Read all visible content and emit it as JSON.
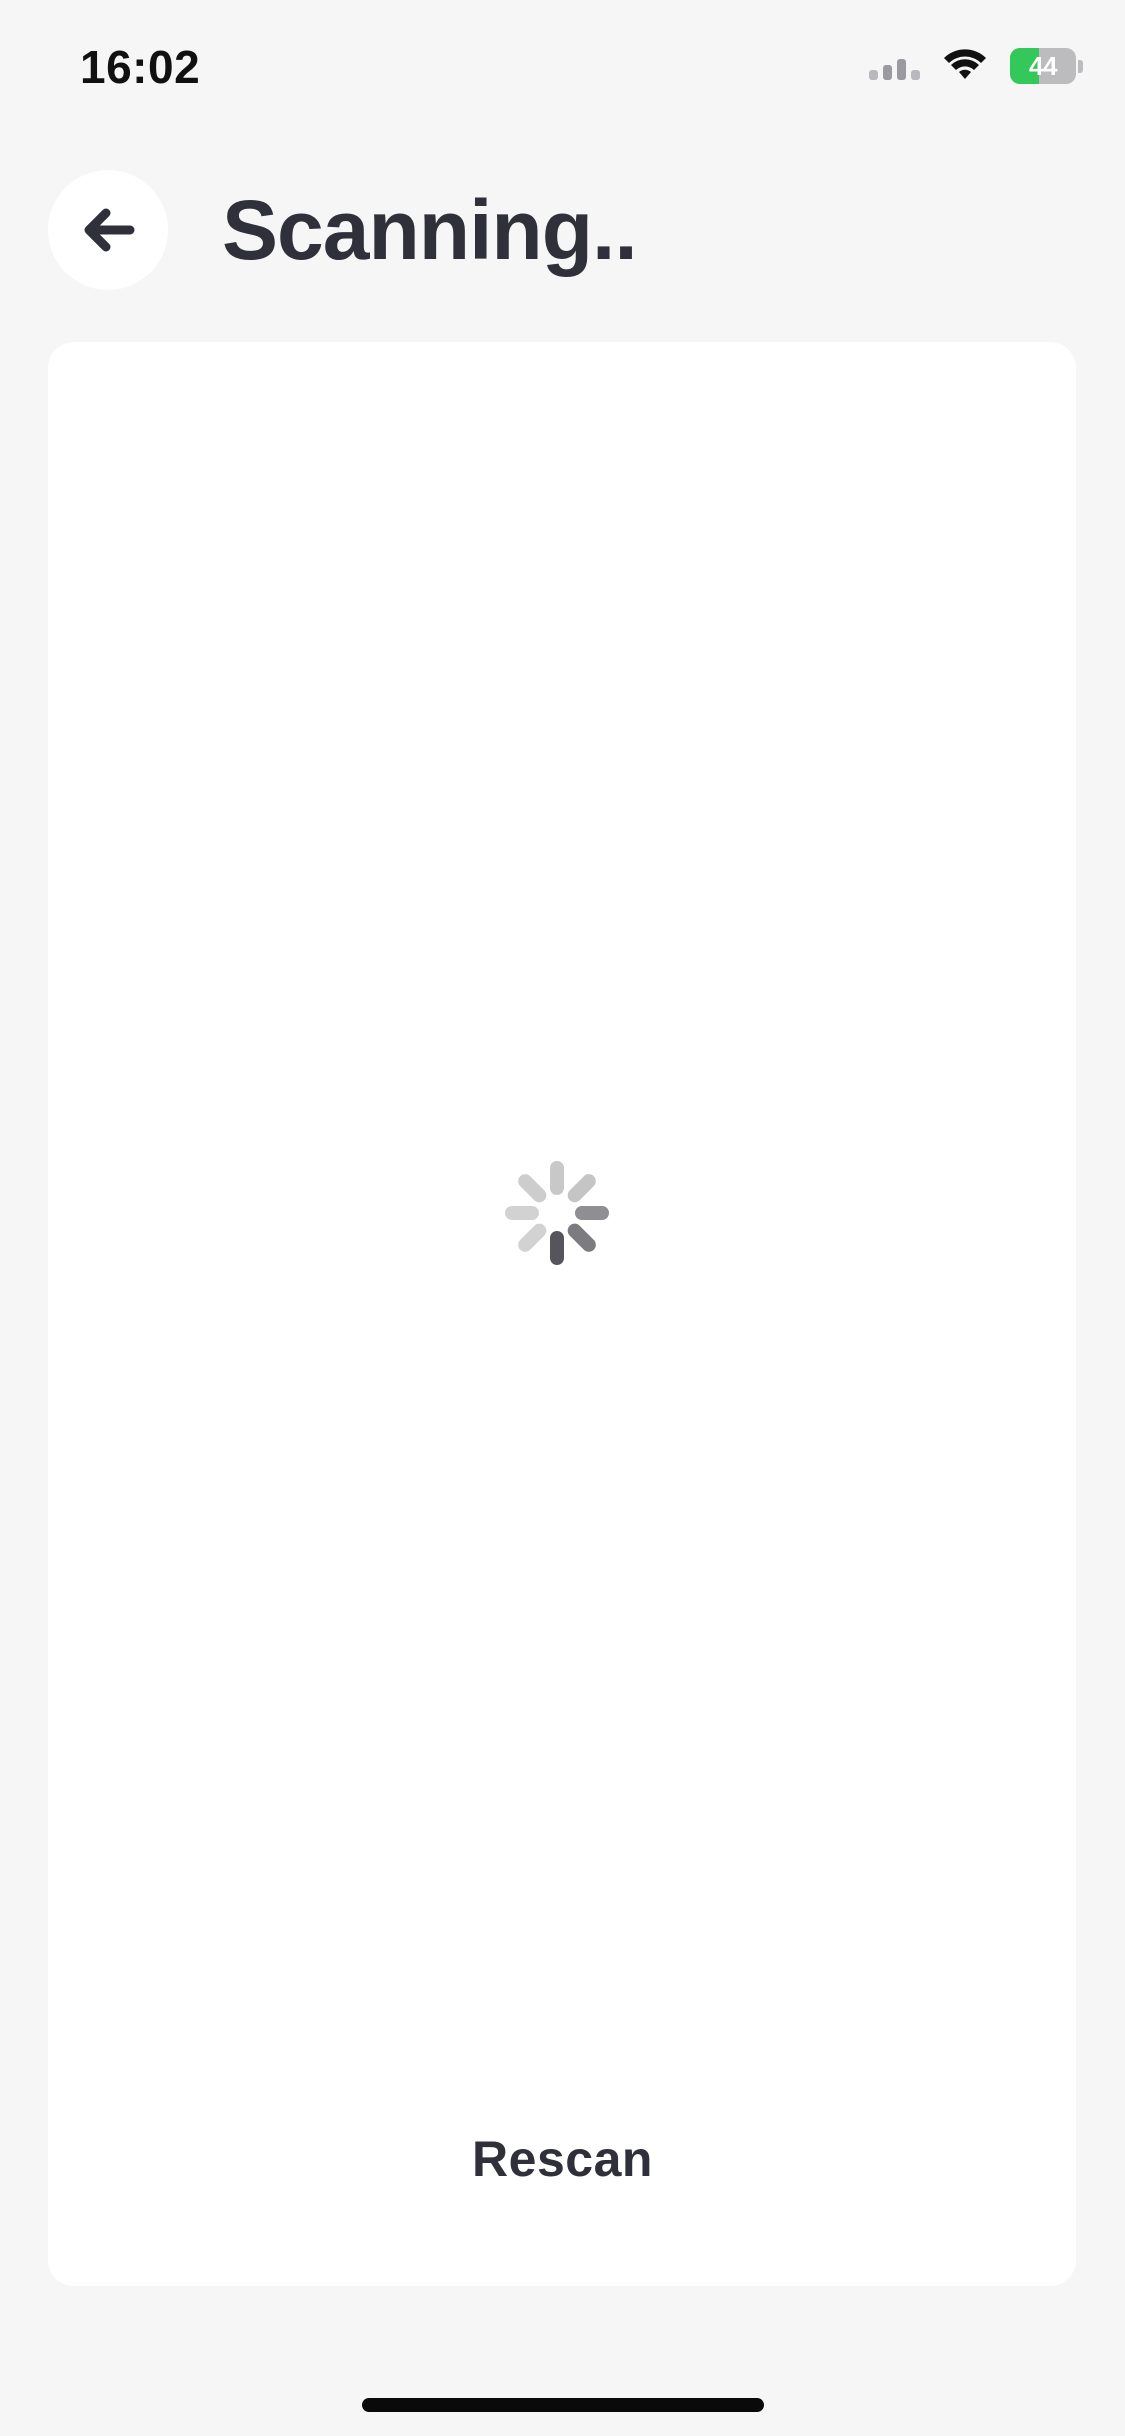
{
  "status_bar": {
    "time": "16:02",
    "battery_level": "44",
    "icons": [
      "cellular-signal-icon",
      "wifi-icon",
      "battery-icon"
    ]
  },
  "header": {
    "title": "Scanning..",
    "back_icon": "arrow-left-icon"
  },
  "main": {
    "loading_icon": "spinner-icon",
    "rescan_label": "Rescan"
  },
  "colors": {
    "background": "#f6f6f6",
    "card": "#ffffff",
    "text_primary": "#2f3039",
    "battery_green": "#34c759"
  }
}
